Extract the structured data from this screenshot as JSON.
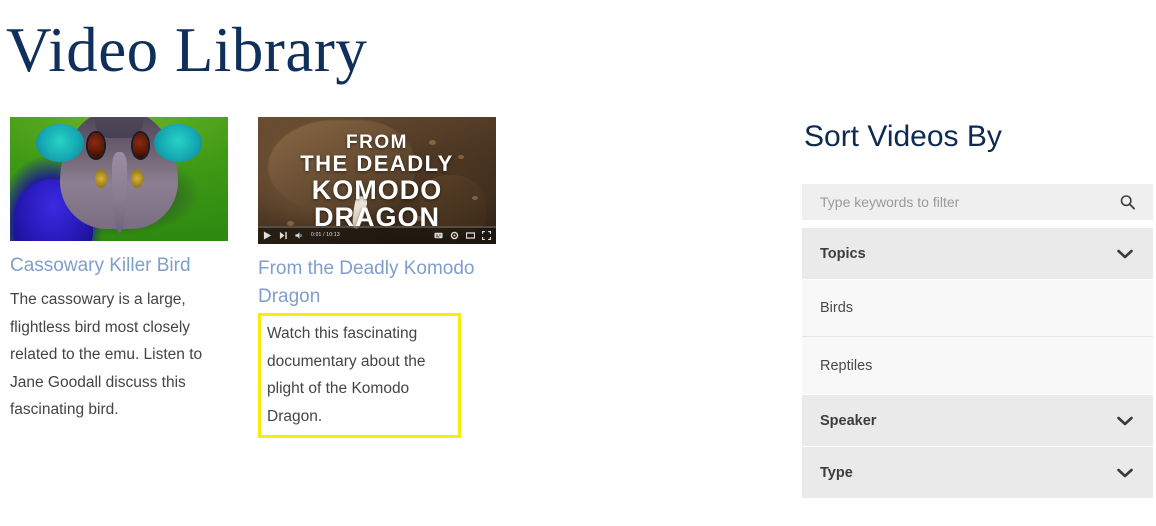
{
  "page": {
    "title": "Video Library",
    "title_color": "#10305c"
  },
  "videos": [
    {
      "title": "Cassowary Killer Bird",
      "description": "The cassowary is a large, flightless bird most closely related to the emu. Listen to Jane Goodall discuss this fascinating bird.",
      "thumbnail_alt": "cassowary-photo",
      "highlighted": false
    },
    {
      "title": "From the Deadly Komodo Dragon",
      "description": "Watch this fascinating documentary about the plight of the Komodo Dragon.",
      "thumbnail_alt": "komodo-dragon-video",
      "highlighted": true,
      "highlight_color": "#fbec08",
      "overlay": {
        "line1": "FROM",
        "line2": "THE DEADLY",
        "line3": "KOMODO DRAGON"
      },
      "player": {
        "time": "0:01 / 10:13",
        "play_icon": "play-icon",
        "next_icon": "next-icon",
        "volume_icon": "volume-icon",
        "subtitles_icon": "subtitles-icon",
        "settings_icon": "settings-icon",
        "theater_icon": "theater-mode-icon",
        "fullscreen_icon": "fullscreen-icon"
      }
    }
  ],
  "sidebar": {
    "heading": "Sort Videos By",
    "search": {
      "placeholder": "Type keywords to filter",
      "value": "",
      "icon": "search-icon"
    },
    "filters": [
      {
        "label": "Topics",
        "expanded": true,
        "chevron": "chevron-down-icon",
        "items": [
          "Birds",
          "Reptiles"
        ]
      },
      {
        "label": "Speaker",
        "expanded": false,
        "chevron": "chevron-down-icon",
        "items": []
      },
      {
        "label": "Type",
        "expanded": false,
        "chevron": "chevron-down-icon",
        "items": []
      }
    ]
  },
  "colors": {
    "link": "#7e9ecb",
    "heading_navy": "#0d2a50",
    "body_text": "#444444",
    "panel_header_bg": "#eaeaea",
    "panel_item_bg": "#f8f8f8",
    "search_bg": "#efefef",
    "highlight_yellow": "#fbec08"
  }
}
